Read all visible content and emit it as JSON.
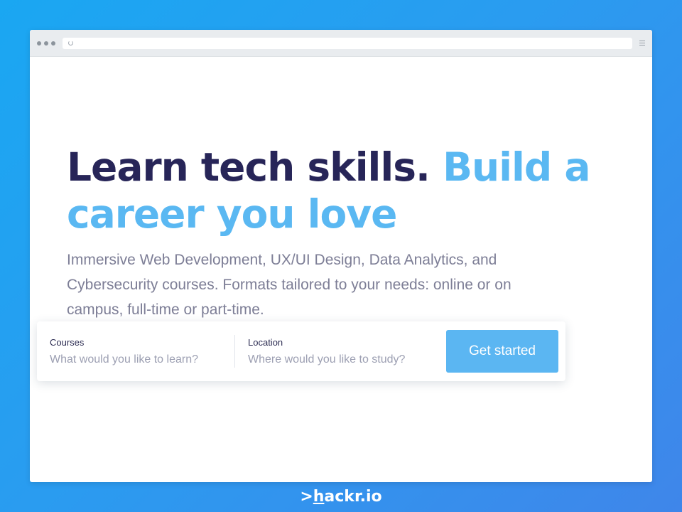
{
  "hero": {
    "headline_dark": "Learn tech skills.",
    "headline_light": "Build a career you love",
    "subtitle": "Immersive Web Development, UX/UI Design, Data Analytics, and Cybersecurity courses. Formats tailored to your needs: online or on campus, full-time or part-time."
  },
  "search": {
    "courses_label": "Courses",
    "courses_placeholder": "What would you like to learn?",
    "location_label": "Location",
    "location_placeholder": "Where would you like to study?",
    "cta_label": "Get started"
  },
  "brand": {
    "prefix": ">",
    "underlined": "h",
    "rest": "ackr.io"
  },
  "colors": {
    "background": "#2a9cf0",
    "headline_dark": "#272558",
    "headline_light": "#5ab8f2",
    "cta": "#5bb6f2"
  }
}
